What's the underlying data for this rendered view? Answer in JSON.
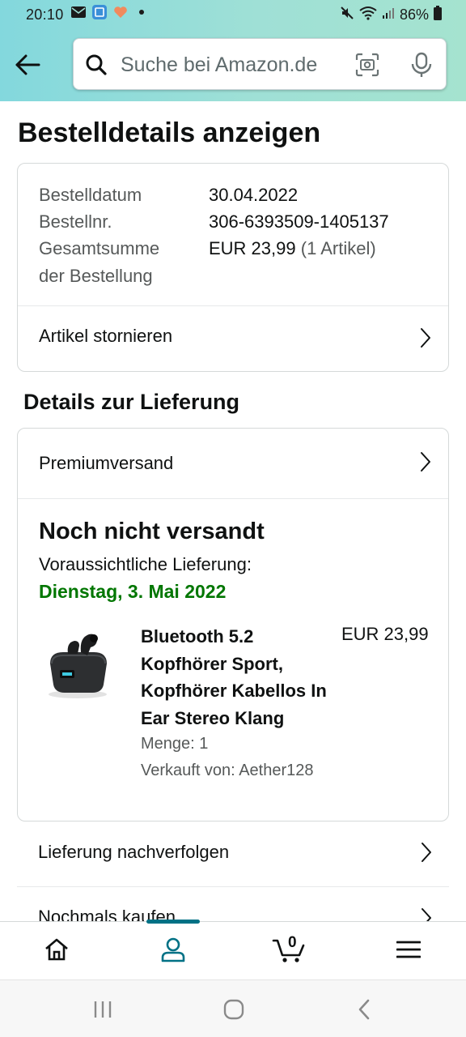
{
  "status_bar": {
    "time": "20:10",
    "battery": "86%"
  },
  "search": {
    "placeholder": "Suche bei Amazon.de"
  },
  "page": {
    "title": "Bestelldetails anzeigen"
  },
  "order_summary": {
    "date_label": "Bestelldatum",
    "date_value": "30.04.2022",
    "number_label": "Bestellnr.",
    "number_value": "306-6393509-1405137",
    "total_label_line1": "Gesamtsumme",
    "total_label_line2": "der Bestellung",
    "total_value": "EUR 23,99",
    "total_items": "(1 Artikel)",
    "cancel_label": "Artikel stornieren"
  },
  "delivery": {
    "section_title": "Details zur Lieferung",
    "shipping_method": "Premiumversand",
    "status": "Noch nicht versandt",
    "eta_label": "Voraussichtliche Lieferung:",
    "eta_date": "Dienstag, 3. Mai 2022",
    "product": {
      "title": "Bluetooth 5.2 Kopfhörer Sport, Kopfhörer Kabellos In Ear Stereo Klang",
      "price": "EUR 23,99",
      "quantity": "Menge: 1",
      "seller": "Verkauft von: Aether128"
    }
  },
  "actions": {
    "track": "Lieferung nachverfolgen",
    "buy_again": "Nochmals kaufen"
  },
  "bottom_nav": {
    "cart_count": "0",
    "active": "account"
  },
  "colors": {
    "header_gradient_start": "#83d8dd",
    "header_gradient_end": "#a5e3cf",
    "eta_green": "#007600",
    "nav_active": "#007185"
  }
}
